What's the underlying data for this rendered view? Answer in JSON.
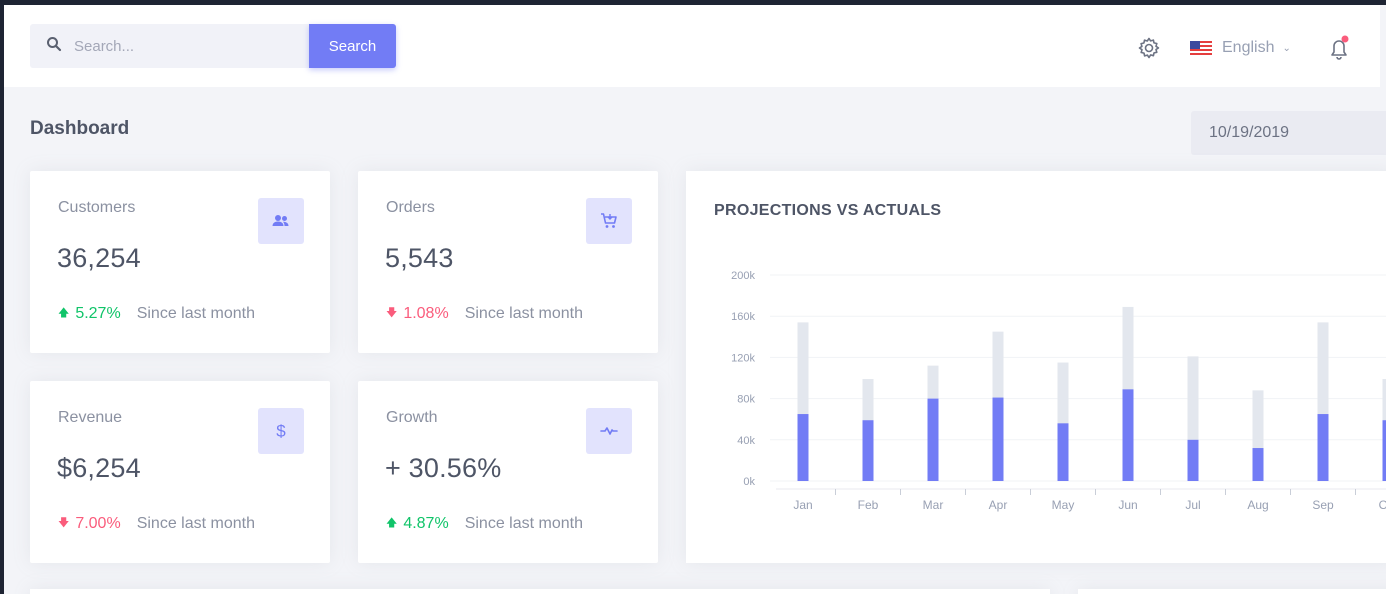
{
  "topbar": {
    "search_placeholder": "Search...",
    "search_button": "Search",
    "language": "English"
  },
  "page": {
    "title": "Dashboard",
    "date": "10/19/2019"
  },
  "cards": [
    {
      "label": "Customers",
      "value": "36,254",
      "trend_dir": "up",
      "trend": "5.27%",
      "since": "Since last month",
      "icon": "users-icon"
    },
    {
      "label": "Orders",
      "value": "5,543",
      "trend_dir": "down",
      "trend": "1.08%",
      "since": "Since last month",
      "icon": "cart-icon"
    },
    {
      "label": "Revenue",
      "value": "$6,254",
      "trend_dir": "down",
      "trend": "7.00%",
      "since": "Since last month",
      "icon": "dollar-icon"
    },
    {
      "label": "Growth",
      "value": "+ 30.56%",
      "trend_dir": "up",
      "trend": "4.87%",
      "since": "Since last month",
      "icon": "pulse-icon"
    }
  ],
  "colors": {
    "accent": "#727cf5",
    "projection": "#e3e7ee",
    "up": "#10c469",
    "down": "#fa5c7c"
  },
  "chart_data": {
    "type": "bar",
    "title": "PROJECTIONS VS ACTUALS",
    "categories": [
      "Jan",
      "Feb",
      "Mar",
      "Apr",
      "May",
      "Jun",
      "Jul",
      "Aug",
      "Sep",
      "Oct"
    ],
    "series": [
      {
        "key": "actual",
        "values": [
          65,
          59,
          80,
          81,
          56,
          89,
          40,
          32,
          65,
          59
        ]
      },
      {
        "key": "projection",
        "values": [
          154,
          99,
          112,
          145,
          115,
          169,
          121,
          88,
          154,
          99
        ]
      }
    ],
    "y_ticks": [
      "200k",
      "160k",
      "120k",
      "80k",
      "40k",
      "0k"
    ],
    "ylim": [
      0,
      200
    ],
    "grid": true
  }
}
